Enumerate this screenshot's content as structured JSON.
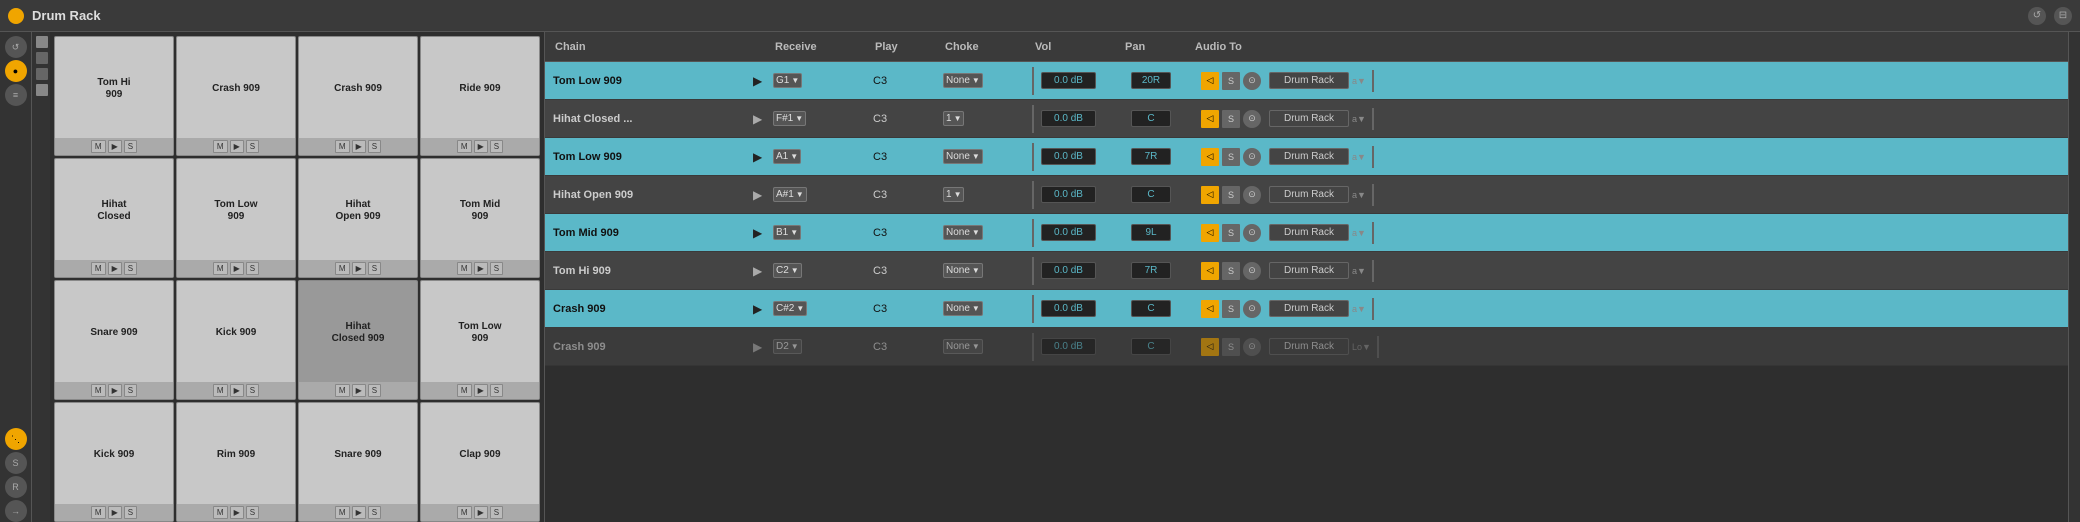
{
  "title": "Drum Rack",
  "pads": [
    {
      "name": "Tom Hi 909",
      "row": 0,
      "col": 0
    },
    {
      "name": "Crash 909",
      "row": 0,
      "col": 1
    },
    {
      "name": "Crash 909",
      "row": 0,
      "col": 2
    },
    {
      "name": "Ride 909",
      "row": 0,
      "col": 3
    },
    {
      "name": "Hihat Closed",
      "row": 1,
      "col": 0
    },
    {
      "name": "Tom Low 909",
      "row": 1,
      "col": 1
    },
    {
      "name": "Hihat Open 909",
      "row": 1,
      "col": 2
    },
    {
      "name": "Tom Mid 909",
      "row": 1,
      "col": 3
    },
    {
      "name": "Snare 909",
      "row": 2,
      "col": 0
    },
    {
      "name": "Kick 909",
      "row": 2,
      "col": 1
    },
    {
      "name": "Hihat Closed 909",
      "row": 2,
      "col": 2
    },
    {
      "name": "Tom Low 909",
      "row": 2,
      "col": 3
    },
    {
      "name": "Kick 909",
      "row": 3,
      "col": 0
    },
    {
      "name": "Rim 909",
      "row": 3,
      "col": 1
    },
    {
      "name": "Snare 909",
      "row": 3,
      "col": 2
    },
    {
      "name": "Clap 909",
      "row": 3,
      "col": 3
    }
  ],
  "headers": {
    "chain": "Chain",
    "receive": "Receive",
    "play": "Play",
    "choke": "Choke",
    "vol": "Vol",
    "pan": "Pan",
    "audio_to": "Audio To"
  },
  "chains": [
    {
      "name": "Tom Low 909",
      "style": "cyan",
      "active": true,
      "receive": "G1",
      "play": "C3",
      "choke": "None",
      "vol": "0.0 dB",
      "pan": "20R",
      "audio_to": "Drum Rack",
      "vol_bar": true
    },
    {
      "name": "Hihat Closed ...",
      "style": "grey",
      "active": false,
      "receive": "F#1",
      "play": "C3",
      "choke": "1",
      "vol": "0.0 dB",
      "pan": "C",
      "audio_to": "Drum Rack",
      "vol_bar": true
    },
    {
      "name": "Tom Low 909",
      "style": "cyan",
      "active": false,
      "receive": "A1",
      "play": "C3",
      "choke": "None",
      "vol": "0.0 dB",
      "pan": "7R",
      "audio_to": "Drum Rack",
      "vol_bar": true
    },
    {
      "name": "Hihat Open 909",
      "style": "grey",
      "active": false,
      "receive": "A#1",
      "play": "C3",
      "choke": "1",
      "vol": "0.0 dB",
      "pan": "C",
      "audio_to": "Drum Rack",
      "vol_bar": true
    },
    {
      "name": "Tom Mid 909",
      "style": "cyan",
      "active": false,
      "receive": "B1",
      "play": "C3",
      "choke": "None",
      "vol": "0.0 dB",
      "pan": "9L",
      "audio_to": "Drum Rack",
      "vol_bar": true
    },
    {
      "name": "Tom Hi 909",
      "style": "grey",
      "active": false,
      "receive": "C2",
      "play": "C3",
      "choke": "None",
      "vol": "0.0 dB",
      "pan": "7R",
      "audio_to": "Drum Rack",
      "vol_bar": true
    },
    {
      "name": "Crash 909",
      "style": "cyan",
      "active": false,
      "receive": "C#2",
      "play": "C3",
      "choke": "None",
      "vol": "0.0 dB",
      "pan": "C",
      "audio_to": "Drum Rack",
      "vol_bar": true
    },
    {
      "name": "Crash 909",
      "style": "grey",
      "active": false,
      "receive": "D2",
      "play": "C3",
      "choke": "None",
      "vol": "0.0 dB",
      "pan": "C",
      "audio_to": "Drum Rack",
      "vol_bar": true,
      "partial": true
    }
  ],
  "left_controls": [
    {
      "label": "↺",
      "active": false
    },
    {
      "label": "○",
      "active": true,
      "yellow": true
    },
    {
      "label": "≡",
      "active": false
    }
  ]
}
